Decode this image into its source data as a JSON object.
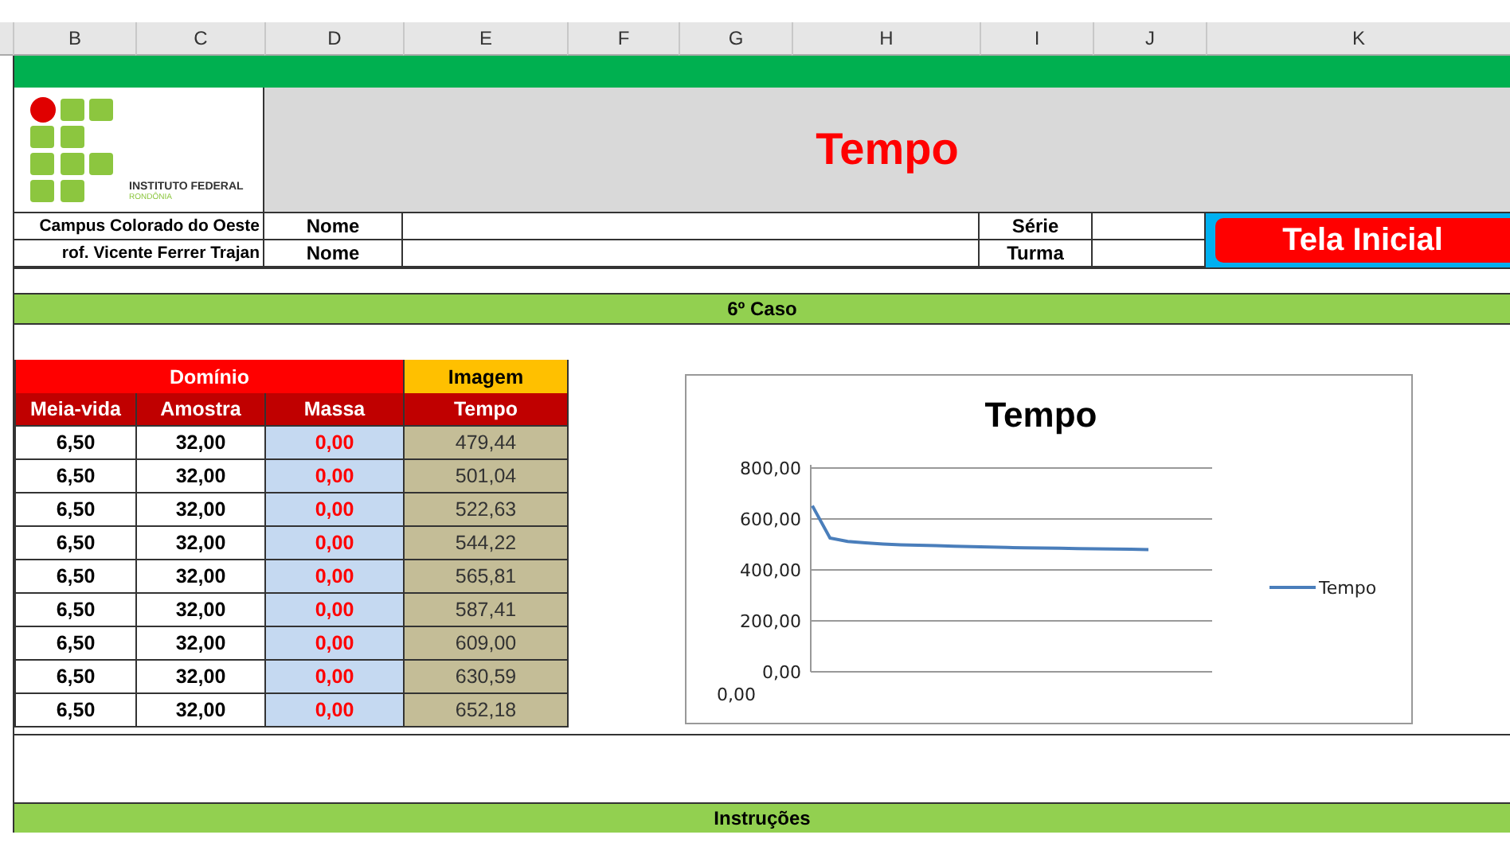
{
  "column_headers": [
    "B",
    "C",
    "D",
    "E",
    "F",
    "G",
    "H",
    "I",
    "J",
    "K"
  ],
  "logo": {
    "name": "INSTITUTO FEDERAL",
    "sub": "RONDÔNIA"
  },
  "title": "Tempo",
  "info_rows": [
    {
      "text": "Campus Colorado do Oeste",
      "label": "Nome",
      "label2": "Série"
    },
    {
      "text": "rof. Vicente Ferrer Trajan",
      "label": "Nome",
      "label2": "Turma"
    }
  ],
  "home_button": "Tela Inicial",
  "section_bar": "6º Caso",
  "table": {
    "groups": [
      {
        "label": "Domínio",
        "color": "#ff0000"
      },
      {
        "label": "Imagem",
        "color": "#ffc000"
      }
    ],
    "columns": [
      {
        "label": "Meia-vida",
        "kind": "given"
      },
      {
        "label": "Amostra",
        "kind": "given"
      },
      {
        "label": "Massa",
        "kind": "input"
      },
      {
        "label": "Tempo",
        "kind": "output"
      }
    ],
    "rows": [
      [
        "6,50",
        "32,00",
        "0,00",
        "479,44"
      ],
      [
        "6,50",
        "32,00",
        "0,00",
        "501,04"
      ],
      [
        "6,50",
        "32,00",
        "0,00",
        "522,63"
      ],
      [
        "6,50",
        "32,00",
        "0,00",
        "544,22"
      ],
      [
        "6,50",
        "32,00",
        "0,00",
        "565,81"
      ],
      [
        "6,50",
        "32,00",
        "0,00",
        "587,41"
      ],
      [
        "6,50",
        "32,00",
        "0,00",
        "609,00"
      ],
      [
        "6,50",
        "32,00",
        "0,00",
        "630,59"
      ],
      [
        "6,50",
        "32,00",
        "0,00",
        "652,18"
      ]
    ]
  },
  "chart": {
    "chart_data": {
      "type": "line",
      "title": "Tempo",
      "ylim": [
        0,
        800
      ],
      "yticks": [
        {
          "value": 0,
          "label": "0,00"
        },
        {
          "value": 200,
          "label": "200,00"
        },
        {
          "value": 400,
          "label": "400,00"
        },
        {
          "value": 600,
          "label": "600,00"
        },
        {
          "value": 800,
          "label": "800,00"
        }
      ],
      "grid": true,
      "annotations": [
        {
          "text": "0,00"
        }
      ],
      "series": [
        {
          "name": "Tempo",
          "color": "#4a7ebb",
          "values": [
            652,
            525,
            512,
            506,
            502,
            499,
            497,
            495,
            493,
            491,
            490,
            488,
            487,
            486,
            485,
            484,
            483,
            482,
            481,
            480
          ]
        }
      ]
    }
  },
  "footer_bar": "Instruções"
}
